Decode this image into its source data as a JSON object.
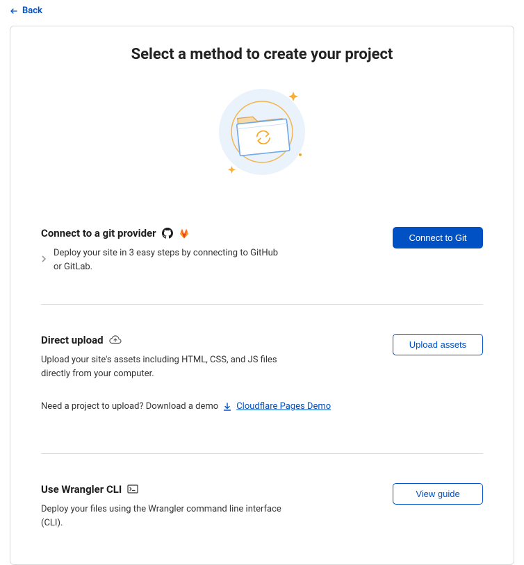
{
  "back_label": "Back",
  "page_title": "Select a method to create your project",
  "sections": {
    "git": {
      "title": "Connect to a git provider",
      "desc": "Deploy your site in 3 easy steps by connecting to GitHub or GitLab.",
      "button": "Connect to Git"
    },
    "upload": {
      "title": "Direct upload",
      "desc": "Upload your site's assets including HTML, CSS, and JS files directly from your computer.",
      "button": "Upload assets",
      "demo_prompt": "Need a project to upload? Download a demo",
      "demo_link": "Cloudflare Pages Demo"
    },
    "wrangler": {
      "title": "Use Wrangler CLI",
      "desc": "Deploy your files using the Wrangler command line interface (CLI).",
      "button": "View guide"
    }
  }
}
